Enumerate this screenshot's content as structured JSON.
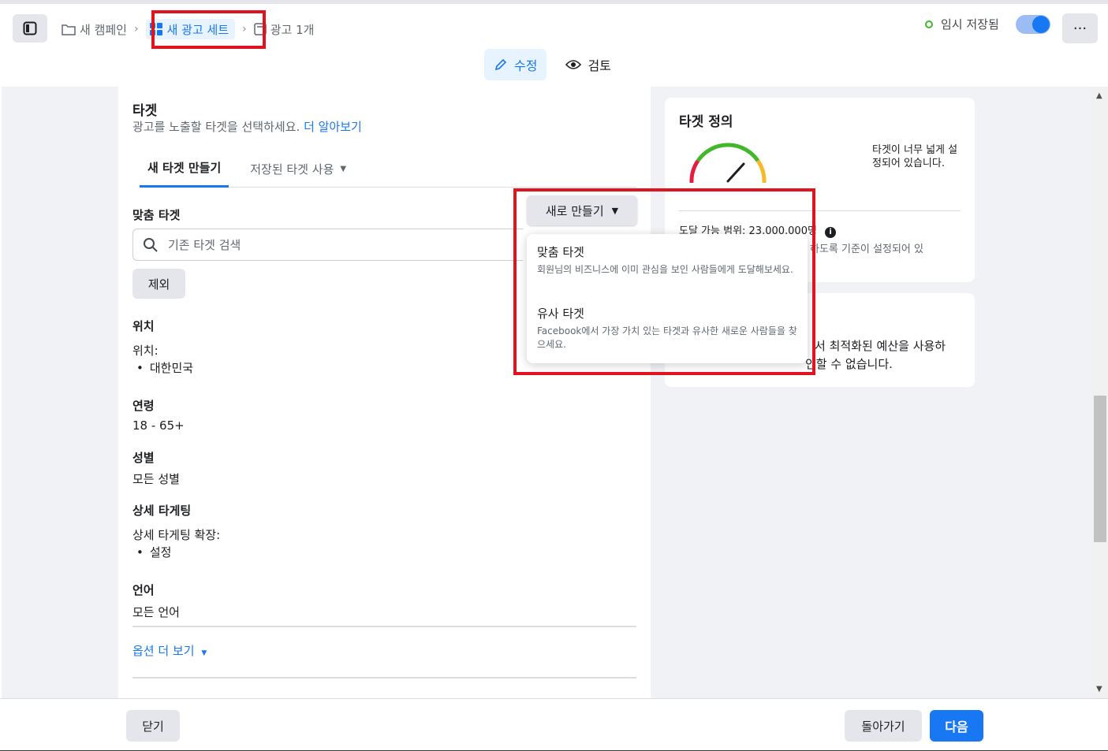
{
  "breadcrumbs": [
    {
      "label": "새 캠페인",
      "icon": "folder-icon"
    },
    {
      "label": "새 광고 세트",
      "icon": "grid-icon"
    },
    {
      "label": "광고 1개",
      "icon": "ad-icon"
    }
  ],
  "status_text": "임시 저장됨",
  "mode_tabs": [
    {
      "label": "수정",
      "icon": "pencil-icon"
    },
    {
      "label": "검토",
      "icon": "eye-icon"
    }
  ],
  "audience": {
    "title": "타겟",
    "description": "광고를 노출할 타겟을 선택하세요.",
    "learn_more": "더 알아보기",
    "tabs": [
      "새 타겟 만들기",
      "저장된 타겟 사용"
    ],
    "custom_audience_label": "맞춤 타겟",
    "search_placeholder": "기존 타겟 검색",
    "exclude_button": "제외",
    "location_label": "위치",
    "location_sub": "위치:",
    "location_value": "대한민국",
    "age_label": "연령",
    "age_value": "18 - 65+",
    "gender_label": "성별",
    "gender_value": "모든 성별",
    "detailed_label": "상세 타게팅",
    "detailed_sub": "상세 타게팅 확장:",
    "detailed_value": "설정",
    "language_label": "언어",
    "language_value": "모든 언어",
    "more_options": "옵션 더 보기"
  },
  "create_new": {
    "button_label": "새로 만들기",
    "items": [
      {
        "title": "맞춤 타겟",
        "desc": "회원님의 비즈니스에 이미 관심을 보인 사람들에게 도달해보세요."
      },
      {
        "title": "유사 타겟",
        "desc": "Facebook에서 가장 가치 있는 타겟과 유사한 새로운 사람들을 찾으세요."
      }
    ]
  },
  "definition": {
    "title": "타겟 정의",
    "warning": "타겟이 너무 넓게 설정되어 있습니다.",
    "reach_label": "도달 가능 범위: 23,000,000명",
    "reach_note": "하도록 기준이 설정되어 있",
    "card2_line1": "서 최적화된 예산을 사용하",
    "card2_line2": "인할 수 없습니다."
  },
  "footer": {
    "close": "닫기",
    "back": "돌아가기",
    "next": "다음"
  },
  "colors": {
    "primary": "#1877f2",
    "annotation_red": "#e0141e",
    "gauge_green": "#42b72a",
    "gauge_red": "#e41e3f",
    "gauge_orange": "#f7b928"
  }
}
